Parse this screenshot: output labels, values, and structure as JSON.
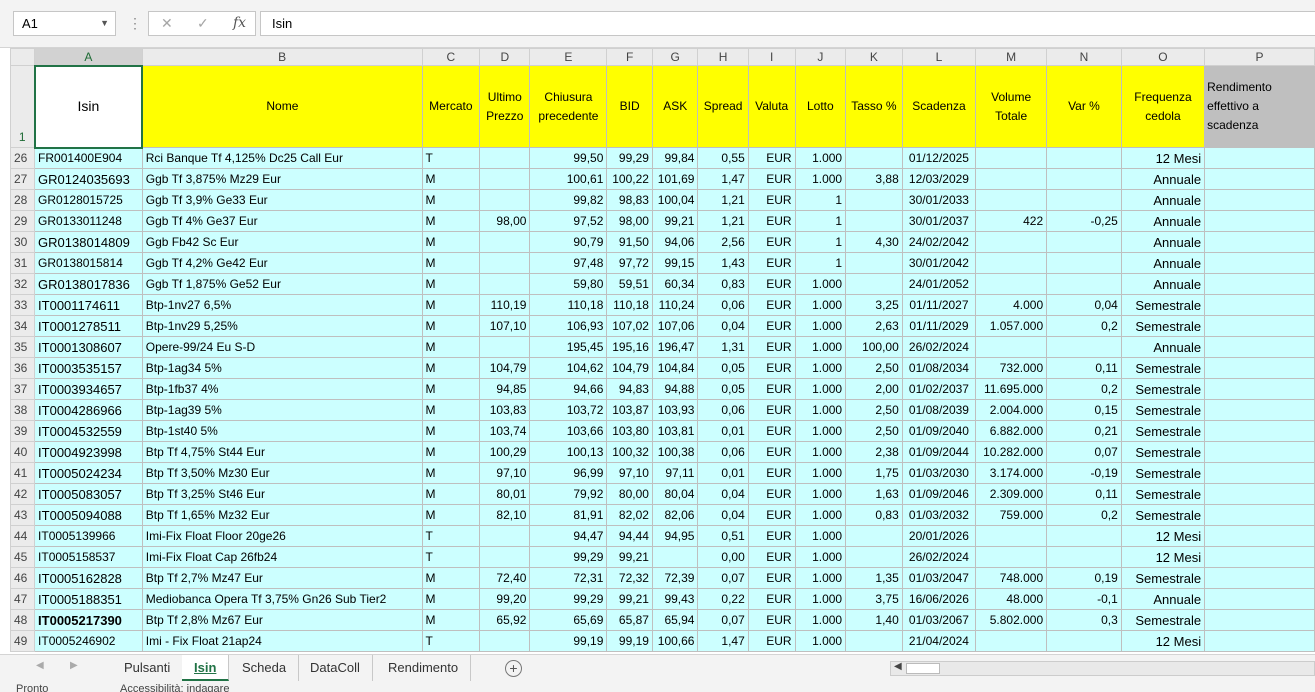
{
  "formula_bar": {
    "name_box": "A1",
    "cancel_icon": "✕",
    "enter_icon": "✓",
    "fx_label": "fx",
    "content": "Isin"
  },
  "columns": [
    "A",
    "B",
    "C",
    "D",
    "E",
    "F",
    "G",
    "H",
    "I",
    "J",
    "K",
    "L",
    "M",
    "N",
    "O",
    "P"
  ],
  "header_row": {
    "row_number": "1",
    "cells": [
      "Isin",
      "Nome",
      "Mercato",
      "Ultimo Prezzo",
      "Chiusura precedente",
      "BID",
      "ASK",
      "Spread",
      "Valuta",
      "Lotto",
      "Tasso %",
      "Scadenza",
      "Volume Totale",
      "Var %",
      "Frequenza cedola",
      "Rendimento effettivo a scadenza"
    ]
  },
  "rows": [
    {
      "n": "26",
      "isin": "FR001400E904",
      "nome": "Rci Banque Tf 4,125% Dc25 Call Eur",
      "mercato": "T",
      "ultimo": "",
      "chiusura": "99,50",
      "bid": "99,29",
      "ask": "99,84",
      "spread": "0,55",
      "valuta": "EUR",
      "lotto": "1.000",
      "tasso": "",
      "scadenza": "01/12/2025",
      "volume": "",
      "var": "",
      "freq": "12 Mesi"
    },
    {
      "n": "27",
      "isin": "GR0124035693",
      "nome": "Ggb Tf 3,875% Mz29 Eur",
      "mercato": "M",
      "ultimo": "",
      "chiusura": "100,61",
      "bid": "100,22",
      "ask": "101,69",
      "spread": "1,47",
      "valuta": "EUR",
      "lotto": "1.000",
      "tasso": "3,88",
      "scadenza": "12/03/2029",
      "volume": "",
      "var": "",
      "freq": "Annuale"
    },
    {
      "n": "28",
      "isin": "GR0128015725",
      "nome": "Ggb Tf 3,9% Ge33 Eur",
      "mercato": "M",
      "ultimo": "",
      "chiusura": "99,82",
      "bid": "98,83",
      "ask": "100,04",
      "spread": "1,21",
      "valuta": "EUR",
      "lotto": "1",
      "tasso": "",
      "scadenza": "30/01/2033",
      "volume": "",
      "var": "",
      "freq": "Annuale"
    },
    {
      "n": "29",
      "isin": "GR0133011248",
      "nome": "Ggb Tf 4% Ge37 Eur",
      "mercato": "M",
      "ultimo": "98,00",
      "chiusura": "97,52",
      "bid": "98,00",
      "ask": "99,21",
      "spread": "1,21",
      "valuta": "EUR",
      "lotto": "1",
      "tasso": "",
      "scadenza": "30/01/2037",
      "volume": "422",
      "var": "-0,25",
      "freq": "Annuale"
    },
    {
      "n": "30",
      "isin": "GR0138014809",
      "nome": "Ggb Fb42 Sc Eur",
      "mercato": "M",
      "ultimo": "",
      "chiusura": "90,79",
      "bid": "91,50",
      "ask": "94,06",
      "spread": "2,56",
      "valuta": "EUR",
      "lotto": "1",
      "tasso": "4,30",
      "scadenza": "24/02/2042",
      "volume": "",
      "var": "",
      "freq": "Annuale"
    },
    {
      "n": "31",
      "isin": "GR0138015814",
      "nome": "Ggb Tf 4,2% Ge42 Eur",
      "mercato": "M",
      "ultimo": "",
      "chiusura": "97,48",
      "bid": "97,72",
      "ask": "99,15",
      "spread": "1,43",
      "valuta": "EUR",
      "lotto": "1",
      "tasso": "",
      "scadenza": "30/01/2042",
      "volume": "",
      "var": "",
      "freq": "Annuale"
    },
    {
      "n": "32",
      "isin": "GR0138017836",
      "nome": "Ggb Tf 1,875% Ge52 Eur",
      "mercato": "M",
      "ultimo": "",
      "chiusura": "59,80",
      "bid": "59,51",
      "ask": "60,34",
      "spread": "0,83",
      "valuta": "EUR",
      "lotto": "1.000",
      "tasso": "",
      "scadenza": "24/01/2052",
      "volume": "",
      "var": "",
      "freq": "Annuale"
    },
    {
      "n": "33",
      "isin": "IT0001174611",
      "nome": "Btp-1nv27 6,5%",
      "mercato": "M",
      "ultimo": "110,19",
      "chiusura": "110,18",
      "bid": "110,18",
      "ask": "110,24",
      "spread": "0,06",
      "valuta": "EUR",
      "lotto": "1.000",
      "tasso": "3,25",
      "scadenza": "01/11/2027",
      "volume": "4.000",
      "var": "0,04",
      "freq": "Semestrale"
    },
    {
      "n": "34",
      "isin": "IT0001278511",
      "nome": "Btp-1nv29 5,25%",
      "mercato": "M",
      "ultimo": "107,10",
      "chiusura": "106,93",
      "bid": "107,02",
      "ask": "107,06",
      "spread": "0,04",
      "valuta": "EUR",
      "lotto": "1.000",
      "tasso": "2,63",
      "scadenza": "01/11/2029",
      "volume": "1.057.000",
      "var": "0,2",
      "freq": "Semestrale"
    },
    {
      "n": "35",
      "isin": "IT0001308607",
      "nome": "Opere-99/24 Eu S-D",
      "mercato": "M",
      "ultimo": "",
      "chiusura": "195,45",
      "bid": "195,16",
      "ask": "196,47",
      "spread": "1,31",
      "valuta": "EUR",
      "lotto": "1.000",
      "tasso": "100,00",
      "scadenza": "26/02/2024",
      "volume": "",
      "var": "",
      "freq": "Annuale"
    },
    {
      "n": "36",
      "isin": "IT0003535157",
      "nome": "Btp-1ag34 5%",
      "mercato": "M",
      "ultimo": "104,79",
      "chiusura": "104,62",
      "bid": "104,79",
      "ask": "104,84",
      "spread": "0,05",
      "valuta": "EUR",
      "lotto": "1.000",
      "tasso": "2,50",
      "scadenza": "01/08/2034",
      "volume": "732.000",
      "var": "0,11",
      "freq": "Semestrale"
    },
    {
      "n": "37",
      "isin": "IT0003934657",
      "nome": "Btp-1fb37 4%",
      "mercato": "M",
      "ultimo": "94,85",
      "chiusura": "94,66",
      "bid": "94,83",
      "ask": "94,88",
      "spread": "0,05",
      "valuta": "EUR",
      "lotto": "1.000",
      "tasso": "2,00",
      "scadenza": "01/02/2037",
      "volume": "11.695.000",
      "var": "0,2",
      "freq": "Semestrale"
    },
    {
      "n": "38",
      "isin": "IT0004286966",
      "nome": "Btp-1ag39 5%",
      "mercato": "M",
      "ultimo": "103,83",
      "chiusura": "103,72",
      "bid": "103,87",
      "ask": "103,93",
      "spread": "0,06",
      "valuta": "EUR",
      "lotto": "1.000",
      "tasso": "2,50",
      "scadenza": "01/08/2039",
      "volume": "2.004.000",
      "var": "0,15",
      "freq": "Semestrale"
    },
    {
      "n": "39",
      "isin": "IT0004532559",
      "nome": "Btp-1st40 5%",
      "mercato": "M",
      "ultimo": "103,74",
      "chiusura": "103,66",
      "bid": "103,80",
      "ask": "103,81",
      "spread": "0,01",
      "valuta": "EUR",
      "lotto": "1.000",
      "tasso": "2,50",
      "scadenza": "01/09/2040",
      "volume": "6.882.000",
      "var": "0,21",
      "freq": "Semestrale"
    },
    {
      "n": "40",
      "isin": "IT0004923998",
      "nome": "Btp Tf 4,75% St44 Eur",
      "mercato": "M",
      "ultimo": "100,29",
      "chiusura": "100,13",
      "bid": "100,32",
      "ask": "100,38",
      "spread": "0,06",
      "valuta": "EUR",
      "lotto": "1.000",
      "tasso": "2,38",
      "scadenza": "01/09/2044",
      "volume": "10.282.000",
      "var": "0,07",
      "freq": "Semestrale"
    },
    {
      "n": "41",
      "isin": "IT0005024234",
      "nome": "Btp Tf 3,50% Mz30 Eur",
      "mercato": "M",
      "ultimo": "97,10",
      "chiusura": "96,99",
      "bid": "97,10",
      "ask": "97,11",
      "spread": "0,01",
      "valuta": "EUR",
      "lotto": "1.000",
      "tasso": "1,75",
      "scadenza": "01/03/2030",
      "volume": "3.174.000",
      "var": "-0,19",
      "freq": "Semestrale"
    },
    {
      "n": "42",
      "isin": "IT0005083057",
      "nome": "Btp Tf 3,25% St46 Eur",
      "mercato": "M",
      "ultimo": "80,01",
      "chiusura": "79,92",
      "bid": "80,00",
      "ask": "80,04",
      "spread": "0,04",
      "valuta": "EUR",
      "lotto": "1.000",
      "tasso": "1,63",
      "scadenza": "01/09/2046",
      "volume": "2.309.000",
      "var": "0,11",
      "freq": "Semestrale"
    },
    {
      "n": "43",
      "isin": "IT0005094088",
      "nome": "Btp Tf 1,65% Mz32 Eur",
      "mercato": "M",
      "ultimo": "82,10",
      "chiusura": "81,91",
      "bid": "82,02",
      "ask": "82,06",
      "spread": "0,04",
      "valuta": "EUR",
      "lotto": "1.000",
      "tasso": "0,83",
      "scadenza": "01/03/2032",
      "volume": "759.000",
      "var": "0,2",
      "freq": "Semestrale"
    },
    {
      "n": "44",
      "isin": "IT0005139966",
      "nome": "Imi-Fix Float Floor 20ge26",
      "mercato": "T",
      "ultimo": "",
      "chiusura": "94,47",
      "bid": "94,44",
      "ask": "94,95",
      "spread": "0,51",
      "valuta": "EUR",
      "lotto": "1.000",
      "tasso": "",
      "scadenza": "20/01/2026",
      "volume": "",
      "var": "",
      "freq": "12 Mesi"
    },
    {
      "n": "45",
      "isin": "IT0005158537",
      "nome": "Imi-Fix Float Cap 26fb24",
      "mercato": "T",
      "ultimo": "",
      "chiusura": "99,29",
      "bid": "99,21",
      "ask": "",
      "spread": "0,00",
      "valuta": "EUR",
      "lotto": "1.000",
      "tasso": "",
      "scadenza": "26/02/2024",
      "volume": "",
      "var": "",
      "freq": "12 Mesi"
    },
    {
      "n": "46",
      "isin": "IT0005162828",
      "nome": "Btp Tf 2,7% Mz47 Eur",
      "mercato": "M",
      "ultimo": "72,40",
      "chiusura": "72,31",
      "bid": "72,32",
      "ask": "72,39",
      "spread": "0,07",
      "valuta": "EUR",
      "lotto": "1.000",
      "tasso": "1,35",
      "scadenza": "01/03/2047",
      "volume": "748.000",
      "var": "0,19",
      "freq": "Semestrale"
    },
    {
      "n": "47",
      "isin": "IT0005188351",
      "nome": "Mediobanca Opera Tf 3,75% Gn26 Sub Tier2",
      "mercato": "M",
      "ultimo": "99,20",
      "chiusura": "99,29",
      "bid": "99,21",
      "ask": "99,43",
      "spread": "0,22",
      "valuta": "EUR",
      "lotto": "1.000",
      "tasso": "3,75",
      "scadenza": "16/06/2026",
      "volume": "48.000",
      "var": "-0,1",
      "freq": "Annuale"
    },
    {
      "n": "48",
      "isin": "IT0005217390",
      "nome": "Btp Tf 2,8% Mz67 Eur",
      "mercato": "M",
      "ultimo": "65,92",
      "chiusura": "65,69",
      "bid": "65,87",
      "ask": "65,94",
      "spread": "0,07",
      "valuta": "EUR",
      "lotto": "1.000",
      "tasso": "1,40",
      "scadenza": "01/03/2067",
      "volume": "5.802.000",
      "var": "0,3",
      "freq": "Semestrale"
    },
    {
      "n": "49",
      "isin": "IT0005246902",
      "nome": "Imi - Fix Float 21ap24",
      "mercato": "T",
      "ultimo": "",
      "chiusura": "99,19",
      "bid": "99,19",
      "ask": "100,66",
      "spread": "1,47",
      "valuta": "EUR",
      "lotto": "1.000",
      "tasso": "",
      "scadenza": "21/04/2024",
      "volume": "",
      "var": "",
      "freq": "12 Mesi"
    }
  ],
  "sheet_tabs": [
    "Pulsanti",
    "Isin",
    "Scheda",
    "DataColl",
    "Rendimento"
  ],
  "active_tab": "Isin",
  "add_sheet_icon": "+",
  "status_bar": {
    "ready": "Pronto",
    "accessibility": "Accessibilità: indagare"
  }
}
